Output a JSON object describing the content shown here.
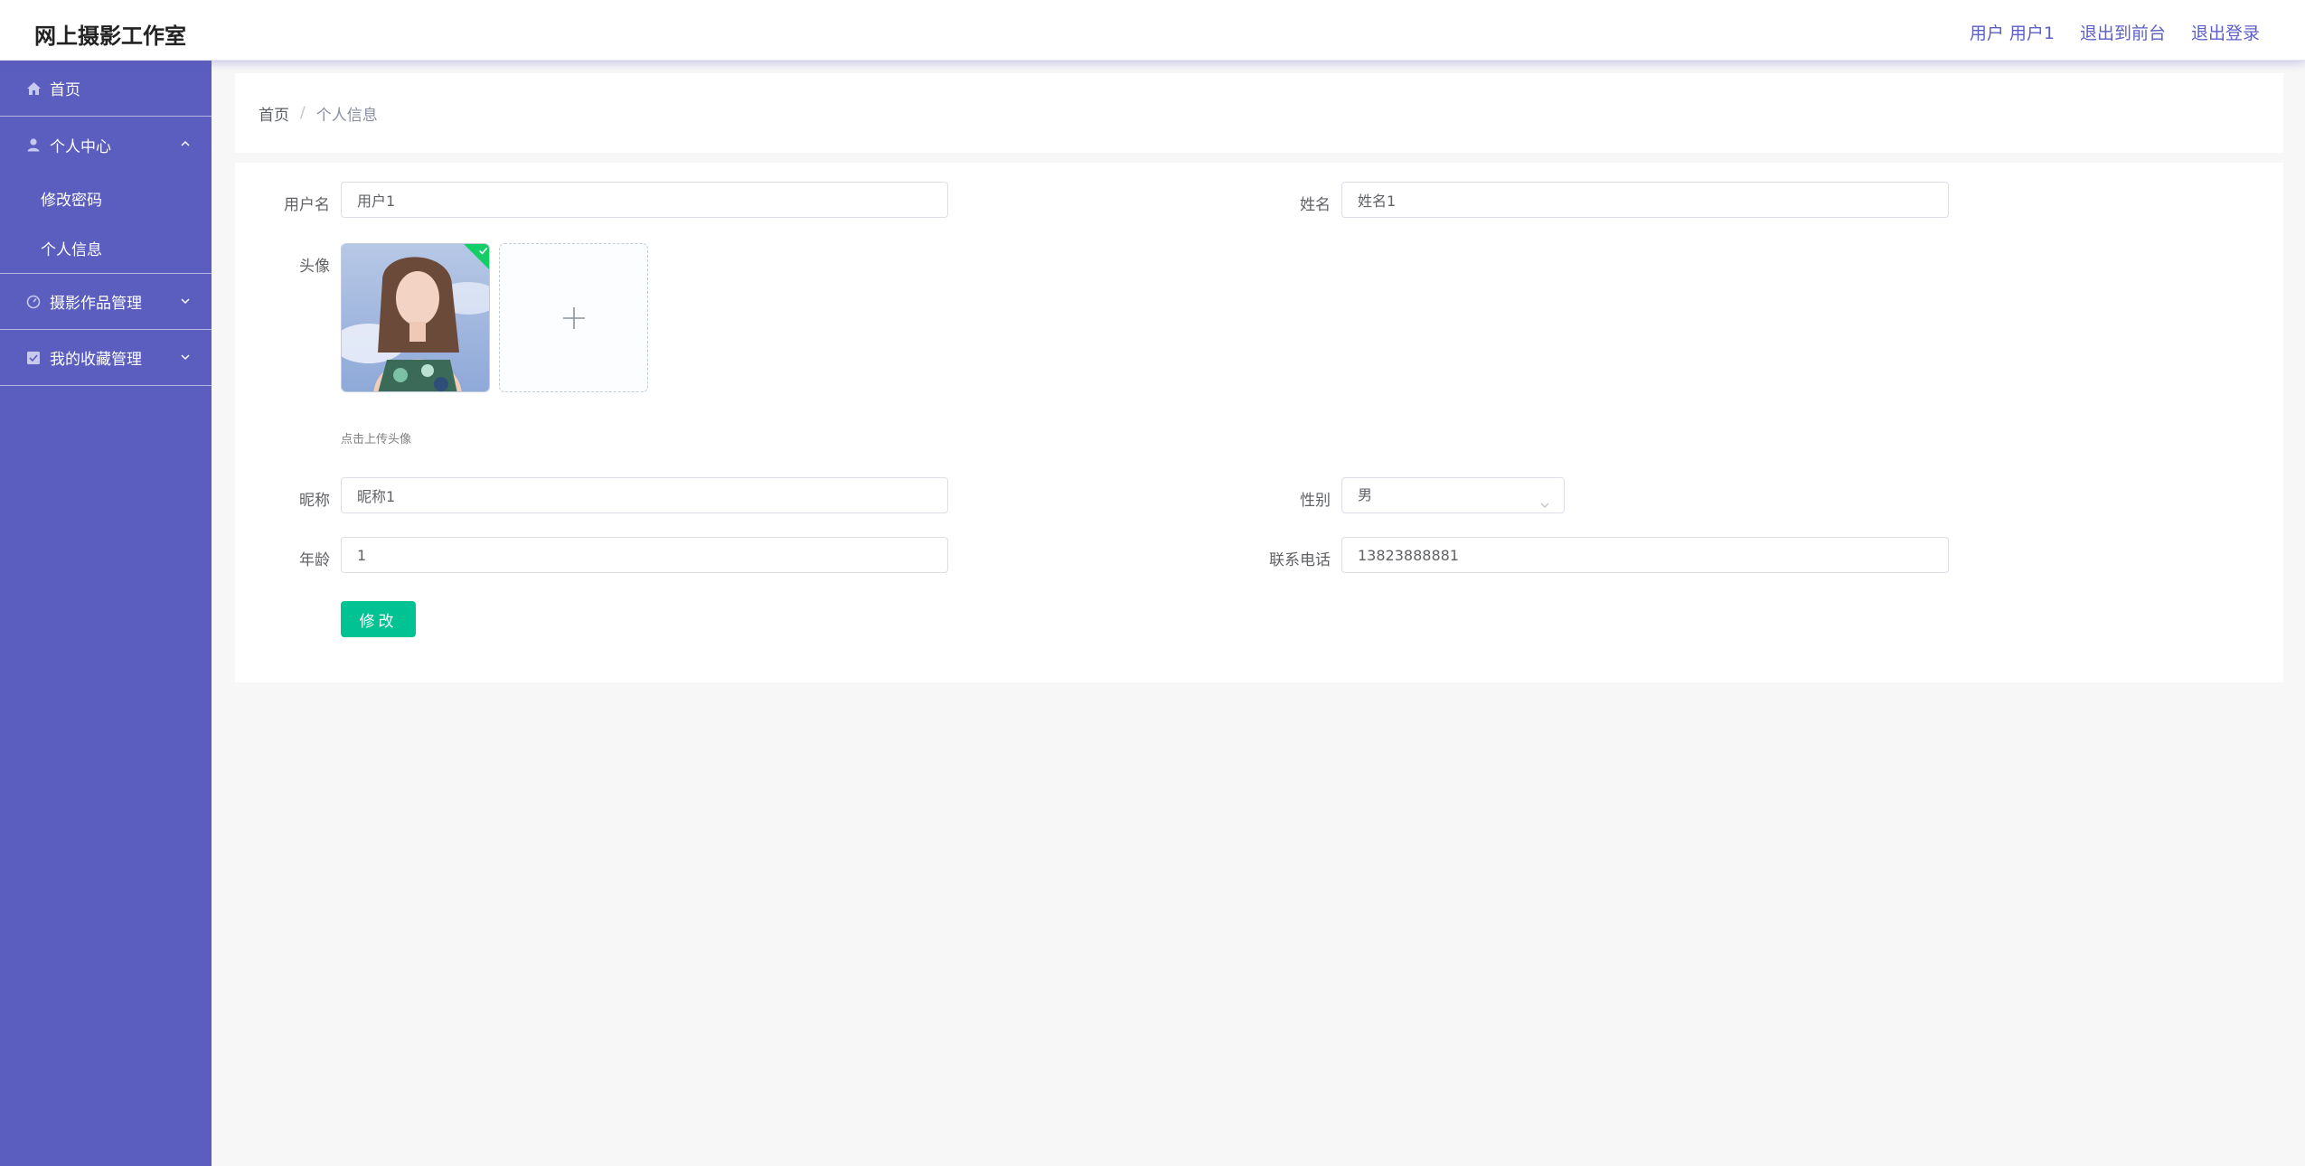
{
  "app": {
    "title": "网上摄影工作室"
  },
  "topbar": {
    "user_label": "用户 用户1",
    "back_to_front": "退出到前台",
    "logout": "退出登录"
  },
  "sidebar": {
    "home": "首页",
    "personal_center": "个人中心",
    "change_password": "修改密码",
    "personal_info": "个人信息",
    "photo_works": "摄影作品管理",
    "my_favorites": "我的收藏管理"
  },
  "breadcrumb": {
    "home": "首页",
    "separator": "/",
    "current": "个人信息"
  },
  "form": {
    "username_label": "用户名",
    "username_value": "用户1",
    "name_label": "姓名",
    "name_value": "姓名1",
    "avatar_label": "头像",
    "avatar_hint": "点击上传头像",
    "nickname_label": "昵称",
    "nickname_value": "昵称1",
    "gender_label": "性别",
    "gender_value": "男",
    "age_label": "年龄",
    "age_value": "1",
    "phone_label": "联系电话",
    "phone_value": "13823888881",
    "submit_label": "修改"
  },
  "colors": {
    "sidebar": "#5b5ebe",
    "accent": "#00c292",
    "link": "#5b5fc7"
  },
  "icons": [
    "home-icon",
    "user-icon",
    "chevron-up-icon",
    "chevron-down-icon",
    "gauge-icon",
    "check-square-icon",
    "plus-icon",
    "success-check-icon"
  ]
}
